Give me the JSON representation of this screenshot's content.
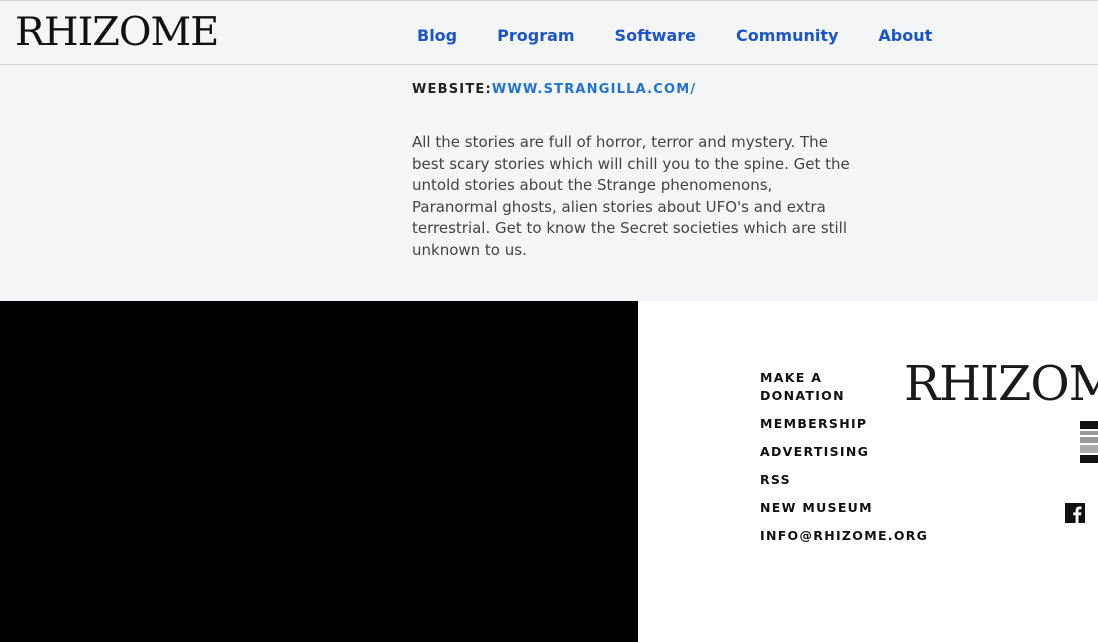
{
  "header": {
    "logo": "RHIZOME",
    "nav": [
      {
        "label": "Blog"
      },
      {
        "label": "Program"
      },
      {
        "label": "Software"
      },
      {
        "label": "Community"
      },
      {
        "label": "About"
      }
    ]
  },
  "main": {
    "website_label": "WEBSITE:",
    "website_value": "WWW.STRANGILLA.COM/",
    "description": "All the stories are full of horror, terror and mystery. The best scary stories which will chill you to the spine. Get the untold stories about the Strange phenomenons, Paranormal ghosts, alien stories about UFO's and extra terrestrial. Get to know the Secret societies which are still unknown to us."
  },
  "footer": {
    "links": [
      {
        "label": "MAKE A DONATION"
      },
      {
        "label": "MEMBERSHIP"
      },
      {
        "label": "ADVERTISING"
      },
      {
        "label": "RSS"
      },
      {
        "label": "NEW MUSEUM"
      },
      {
        "label": "INFO@RHIZOME.ORG"
      }
    ],
    "logo": "RHIZOME",
    "partner_icon": "new-museum-logo-icon",
    "social_icon": "facebook-icon"
  },
  "colors": {
    "nav": "#1c55c7",
    "link": "#1d72d9",
    "footer_black": "#000000"
  }
}
